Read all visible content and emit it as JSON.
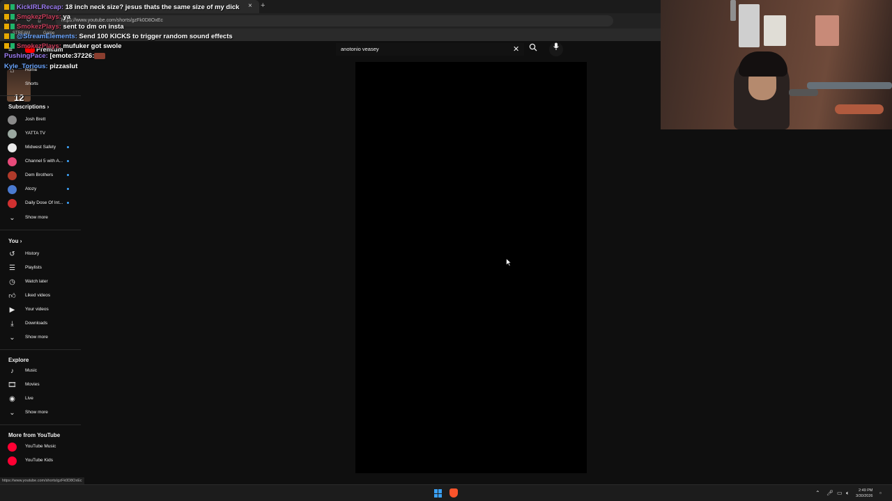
{
  "browser": {
    "tab_close": "×",
    "new_tab": "+",
    "url": "https://www.youtube.com/shorts/gzFk0D8OxEc",
    "bookmarks": [
      "STREAM",
      "Game"
    ]
  },
  "chat": [
    {
      "user": "KickIRLRecap:",
      "message": "18 inch neck size? jesus thats the same size of my dick",
      "color": "purple"
    },
    {
      "user": "SmokezPlays:",
      "message": "ya",
      "color": "orange"
    },
    {
      "user": "SmokezPlays:",
      "message": "sent to dm on insta",
      "color": "orange"
    },
    {
      "user": "@StreamElements:",
      "message": "Send 100 KICKS to trigger random sound effects",
      "color": "blue"
    },
    {
      "user": "SmokezPlays:",
      "message": "mufuker got swole",
      "color": "orange"
    },
    {
      "user": "PushingPace:",
      "message": "[emote:37226:",
      "color": "purple"
    },
    {
      "user": "Kyle_Torious:",
      "message": "pizzaslut",
      "color": "blue"
    }
  ],
  "streamer_badge_number": "12",
  "youtube": {
    "premium_label": "Premium",
    "search_query": "anotonio veasey",
    "sidebar": {
      "home": "Home",
      "shorts": "Shorts",
      "subscriptions_title": "Subscriptions",
      "subscriptions": [
        {
          "label": "Josh Brett",
          "color": "#8a8a8a",
          "dot": false
        },
        {
          "label": "YATTA TV",
          "color": "#9aa8a0",
          "dot": false
        },
        {
          "label": "Midwest Safety",
          "color": "#eaeaea",
          "dot": true
        },
        {
          "label": "Channel 5 with A...",
          "color": "#e84a7a",
          "dot": true
        },
        {
          "label": "Dem Brothers",
          "color": "#b03a2a",
          "dot": true
        },
        {
          "label": "Atozy",
          "color": "#4a7ad0",
          "dot": true
        },
        {
          "label": "Daily Dose Of Int...",
          "color": "#d03030",
          "dot": true
        }
      ],
      "show_more": "Show more",
      "you_title": "You",
      "you_items": [
        {
          "label": "History",
          "icon": "history-icon"
        },
        {
          "label": "Playlists",
          "icon": "playlists-icon"
        },
        {
          "label": "Watch later",
          "icon": "watch-later-icon"
        },
        {
          "label": "Liked videos",
          "icon": "liked-icon"
        },
        {
          "label": "Your videos",
          "icon": "your-videos-icon"
        },
        {
          "label": "Downloads",
          "icon": "downloads-icon"
        }
      ],
      "explore_title": "Explore",
      "explore_items": [
        {
          "label": "Music",
          "icon": "music-icon"
        },
        {
          "label": "Movies",
          "icon": "movies-icon"
        },
        {
          "label": "Live",
          "icon": "live-icon"
        }
      ],
      "more_title": "More from YouTube",
      "more_items": [
        {
          "label": "YouTube Music",
          "color": "#ff0033"
        },
        {
          "label": "YouTube Kids",
          "color": "#ff0033"
        }
      ]
    }
  },
  "status_url": "https://www.youtube.com/shorts/gzFk0D8OxEc",
  "taskbar": {
    "time": "2:49 PM",
    "date": "3/30/2026"
  }
}
